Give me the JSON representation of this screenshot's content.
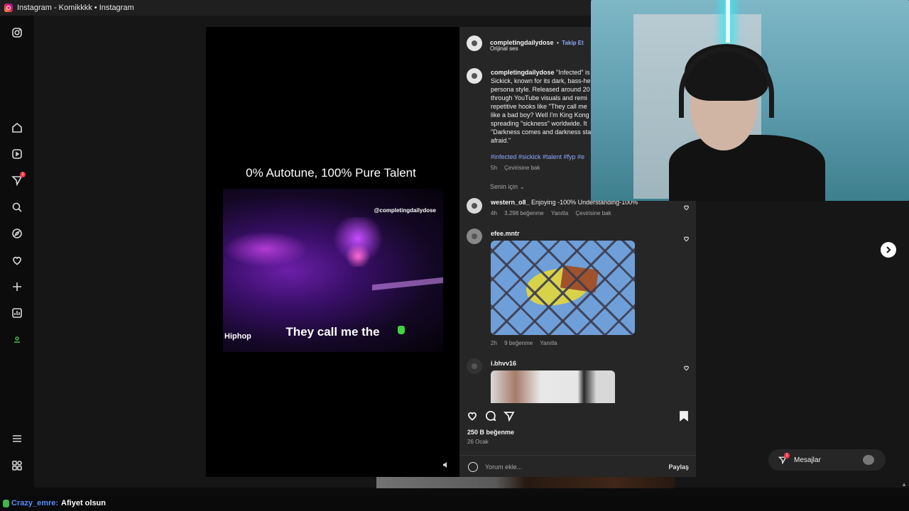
{
  "window": {
    "title": "Instagram - Komikkkk • Instagram"
  },
  "sidebar": {
    "icons": [
      "instagram-icon",
      "home-icon",
      "reels-icon",
      "send-icon",
      "search-icon",
      "explore-icon",
      "heart-icon",
      "create-icon",
      "insights-icon",
      "profile-icon",
      "menu-icon",
      "more-icon"
    ],
    "notification_badge": "1"
  },
  "video": {
    "title": "0% Autotune, 100% Pure Talent",
    "handle": "@completingdailydose",
    "caption": "They call me the",
    "tag": "Hiphop"
  },
  "post": {
    "author": "completingdailydose",
    "separator": "•",
    "follow_label": "Takip Et",
    "audio": "Orijinal ses",
    "description_user": "completingdailydose",
    "description": "\"Infected\" is Sickick, known for its dark, bass-he persona style. Released around 20 through YouTube visuals and remi repetitive hooks like \"They call me like a bad boy? Well I'm King Kong spreading \"sickness\" worldwide. It \"Darkness comes and darkness sta afraid.\"",
    "hashtags": "#infected #sickick #talent #fyp #e",
    "time": "5h",
    "translate": "Çevirisine bak",
    "for_you": "Senin için",
    "likes": "250 B beğenme",
    "date": "26 Ocak",
    "comment_placeholder": "Yorum ekle...",
    "share_label": "Paylaş"
  },
  "comments": [
    {
      "user": "western_o8_",
      "text": "Enjoying -100% Understanding-100%",
      "time": "4h",
      "likes": "3.298 beğenme",
      "reply": "Yanıtla",
      "translate": "Çevirisine bak"
    },
    {
      "user": "efee.mntr",
      "time": "2h",
      "likes": "9 beğenme",
      "reply": "Yanıtla"
    },
    {
      "user": "i.bhvv16"
    }
  ],
  "messages": {
    "label": "Mesajlar",
    "badge": "1"
  },
  "chat": {
    "user": "Crazy_emre:",
    "message": "Afiyet olsun"
  }
}
